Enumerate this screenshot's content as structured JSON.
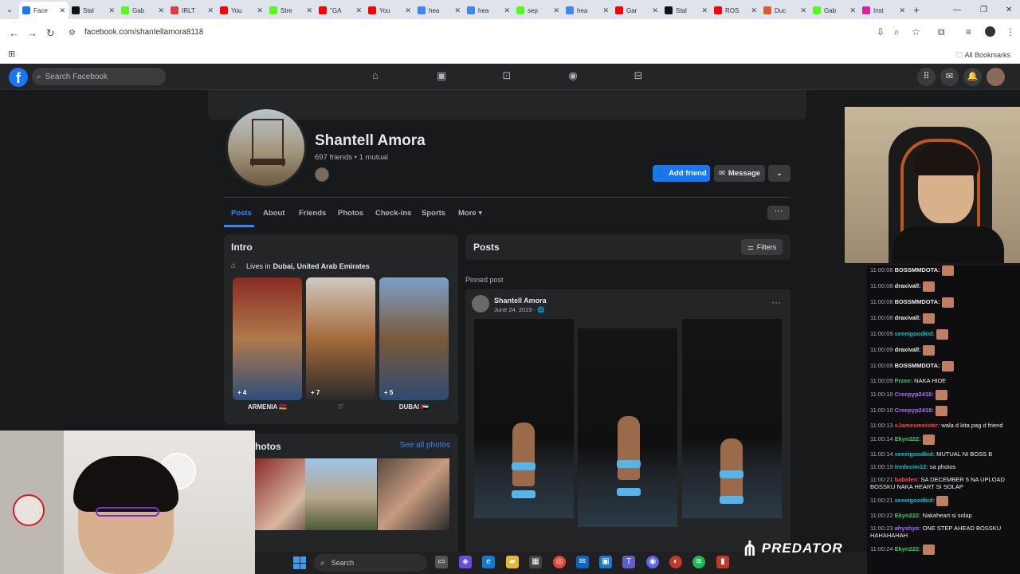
{
  "browser": {
    "tabs": [
      {
        "label": "Face",
        "color": "#1877f2",
        "active": true
      },
      {
        "label": "Stal",
        "color": "#111111"
      },
      {
        "label": "Gab",
        "color": "#53fc18"
      },
      {
        "label": "IRLT",
        "color": "#e23a3a"
      },
      {
        "label": "You",
        "color": "#ff0000"
      },
      {
        "label": "Stre",
        "color": "#53fc18"
      },
      {
        "label": "\"GA",
        "color": "#ff0000"
      },
      {
        "label": "You",
        "color": "#ff0000"
      },
      {
        "label": "hea",
        "color": "#4285f4"
      },
      {
        "label": "hea",
        "color": "#4285f4"
      },
      {
        "label": "sep",
        "color": "#53fc18"
      },
      {
        "label": "hea",
        "color": "#4285f4"
      },
      {
        "label": "Gar",
        "color": "#ff0000"
      },
      {
        "label": "Stal",
        "color": "#111111"
      },
      {
        "label": "ROS",
        "color": "#ff0000"
      },
      {
        "label": "Duc",
        "color": "#de5833"
      },
      {
        "label": "Gab",
        "color": "#53fc18"
      },
      {
        "label": "Inst",
        "color": "#d6249f"
      }
    ],
    "url": "facebook.com/shantellamora8118",
    "all_bookmarks": "All Bookmarks"
  },
  "fbnav": {
    "search_placeholder": "Search Facebook",
    "logo": "f",
    "icons": [
      "home-icon",
      "video-icon",
      "marketplace-icon",
      "groups-icon",
      "gaming-icon"
    ],
    "right_icons": [
      "menu-grid-icon",
      "messenger-icon",
      "bell-icon",
      "account-avatar"
    ]
  },
  "profile": {
    "name": "Shantell Amora",
    "friends": "697 friends • 1 mutual",
    "add_friend": "Add friend",
    "message": "Message",
    "tabs": [
      "Posts",
      "About",
      "Friends",
      "Photos",
      "Check-ins",
      "Sports",
      "More"
    ]
  },
  "intro": {
    "title": "Intro",
    "lives_in_label": "Lives in",
    "lives_in_place": "Dubai, United Arab Emirates",
    "featured": [
      {
        "label": "ARMENIA 🇦🇲",
        "count": "+ 4",
        "colors": [
          "#8a2b24",
          "#b07a4a",
          "#2f4d7a"
        ]
      },
      {
        "label": "♡",
        "count": "+ 7",
        "colors": [
          "#cfc9c0",
          "#a56a3b",
          "#2b2b2b"
        ]
      },
      {
        "label": "DUBAI 🇦🇪",
        "count": "+ 5",
        "colors": [
          "#7aa0c8",
          "#7a5a3a",
          "#2e4a72"
        ]
      }
    ]
  },
  "photos": {
    "title": "Photos",
    "see_all": "See all photos"
  },
  "posts": {
    "title": "Posts",
    "filters": "Filters",
    "pinned": "Pinned post",
    "author": "Shantell Amora",
    "date": "June 24, 2023 · 🌐"
  },
  "chat": {
    "messages": [
      {
        "ts": "11:00:08",
        "user": "BOSSMMDOTA:",
        "color": "#efeff1",
        "text": "",
        "emote": true
      },
      {
        "ts": "11:00:08",
        "user": "draxivall:",
        "color": "#efeff1",
        "text": "",
        "emote": true
      },
      {
        "ts": "11:00:08",
        "user": "BOSSMMDOTA:",
        "color": "#efeff1",
        "text": "",
        "emote": true
      },
      {
        "ts": "11:00:08",
        "user": "draxivall:",
        "color": "#efeff1",
        "text": "",
        "emote": true
      },
      {
        "ts": "11:00:09",
        "user": "seeeigoodkid:",
        "color": "#00c2c9",
        "text": "",
        "emote": true
      },
      {
        "ts": "11:00:09",
        "user": "draxivall:",
        "color": "#efeff1",
        "text": "",
        "emote": true
      },
      {
        "ts": "11:00:09",
        "user": "BOSSMMDOTA:",
        "color": "#efeff1",
        "text": "",
        "emote": true
      },
      {
        "ts": "11:00:09",
        "user": "Przee:",
        "color": "#2ecc71",
        "text": "NAKA HIDE",
        "emote": false
      },
      {
        "ts": "11:00:10",
        "user": "Creepyp2418:",
        "color": "#b36bff",
        "text": "",
        "emote": true
      },
      {
        "ts": "11:00:10",
        "user": "Creepyp2418:",
        "color": "#b36bff",
        "text": "",
        "emote": true
      },
      {
        "ts": "11:00:13",
        "user": "xJamesmeister:",
        "color": "#ff4545",
        "text": "wala d kita pag d friend",
        "emote": false
      },
      {
        "ts": "11:00:14",
        "user": "Ekyn222:",
        "color": "#2ecc71",
        "text": "",
        "emote": true
      },
      {
        "ts": "11:00:14",
        "user": "seeeigoodkid:",
        "color": "#00c2c9",
        "text": "MUTUAL NI BOSS B",
        "emote": false
      },
      {
        "ts": "11:00:19",
        "user": "tredecim12:",
        "color": "#00c2c9",
        "text": "sa photos",
        "emote": false
      },
      {
        "ts": "11:00:21",
        "user": "babidex:",
        "color": "#ff4545",
        "text": "SA DECEMBER 5 NA UPLOAD BOSSKU NAKA HEART SI SOLAP",
        "emote": false
      },
      {
        "ts": "11:00:21",
        "user": "seeeigoodkid:",
        "color": "#00c2c9",
        "text": "",
        "emote": true
      },
      {
        "ts": "11:00:22",
        "user": "Ekyn222:",
        "color": "#2ecc71",
        "text": "Nakaheart si solap",
        "emote": false
      },
      {
        "ts": "11:00:23",
        "user": "ahyshyo:",
        "color": "#b36bff",
        "text": "ONE STEP AHEAD BOSSKU HAHAHAHAH",
        "emote": false
      },
      {
        "ts": "11:00:24",
        "user": "Ekyn222:",
        "color": "#2ecc71",
        "text": "",
        "emote": true
      }
    ]
  },
  "taskbar": {
    "search": "Search"
  },
  "brand": {
    "predator": "PREDATOR"
  }
}
